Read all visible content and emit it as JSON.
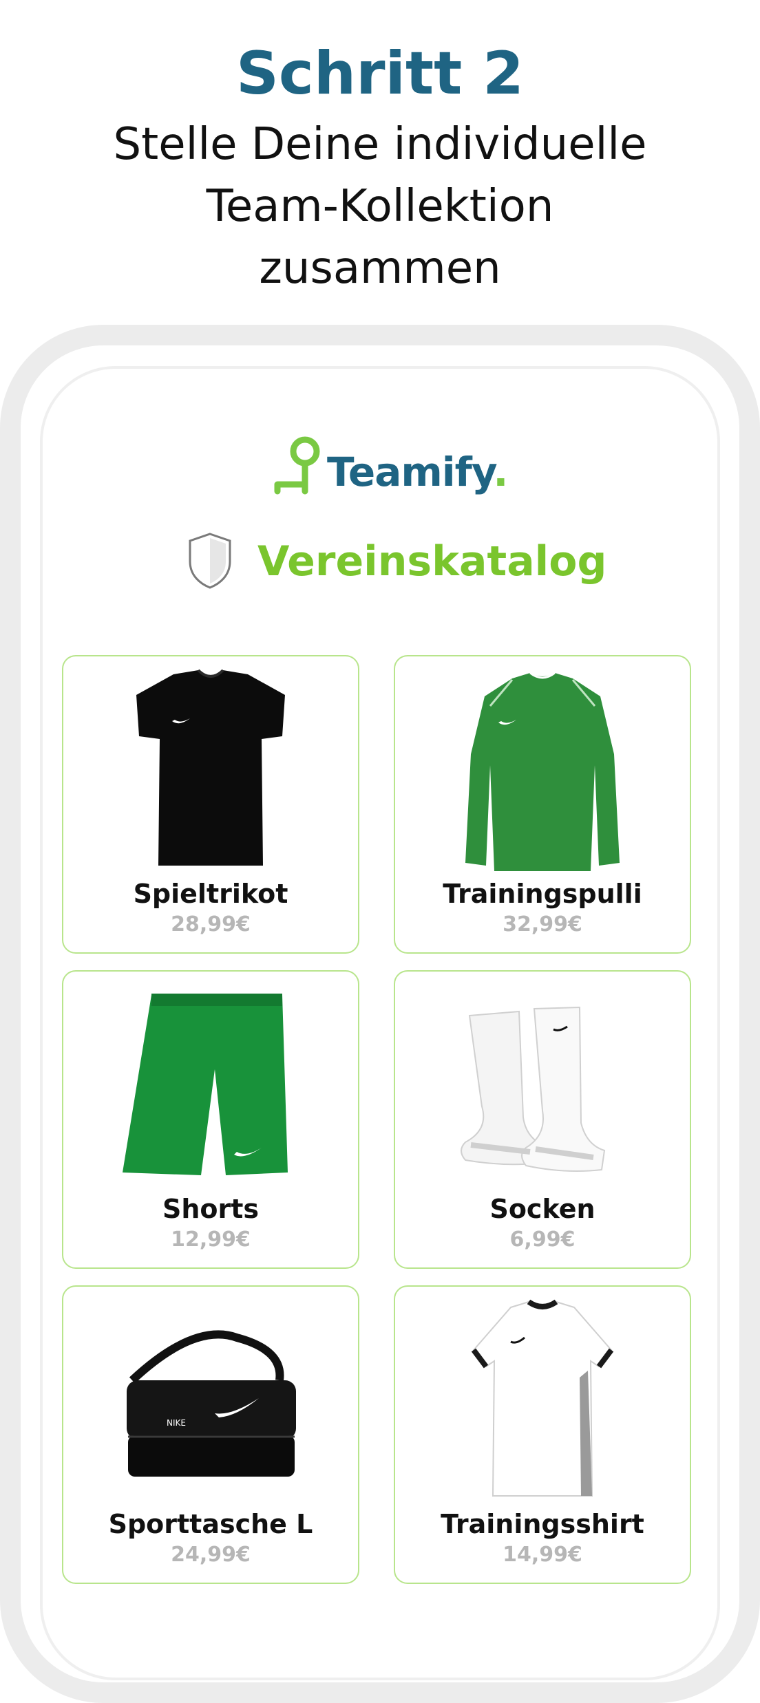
{
  "header": {
    "step_title": "Schritt 2",
    "subtitle_line1": "Stelle Deine individuelle",
    "subtitle_line2": "Team-Kollektion",
    "subtitle_line3": "zusammen"
  },
  "brand": {
    "name": "Teamify",
    "dot": ".",
    "primary_color": "#1f6483",
    "accent_color": "#7ac943"
  },
  "catalog": {
    "icon": "shield-icon",
    "title": "Vereinskatalog",
    "title_color": "#7ac52d",
    "card_border_color": "#b8e58c"
  },
  "products": [
    {
      "name": "Spieltrikot",
      "price": "28,99€",
      "image": "black-jersey"
    },
    {
      "name": "Trainingspulli",
      "price": "32,99€",
      "image": "green-longsleeve"
    },
    {
      "name": "Shorts",
      "price": "12,99€",
      "image": "green-shorts"
    },
    {
      "name": "Socken",
      "price": "6,99€",
      "image": "white-socks"
    },
    {
      "name": "Sporttasche L",
      "price": "24,99€",
      "image": "black-sports-bag"
    },
    {
      "name": "Trainingsshirt",
      "price": "14,99€",
      "image": "white-shirt"
    }
  ]
}
